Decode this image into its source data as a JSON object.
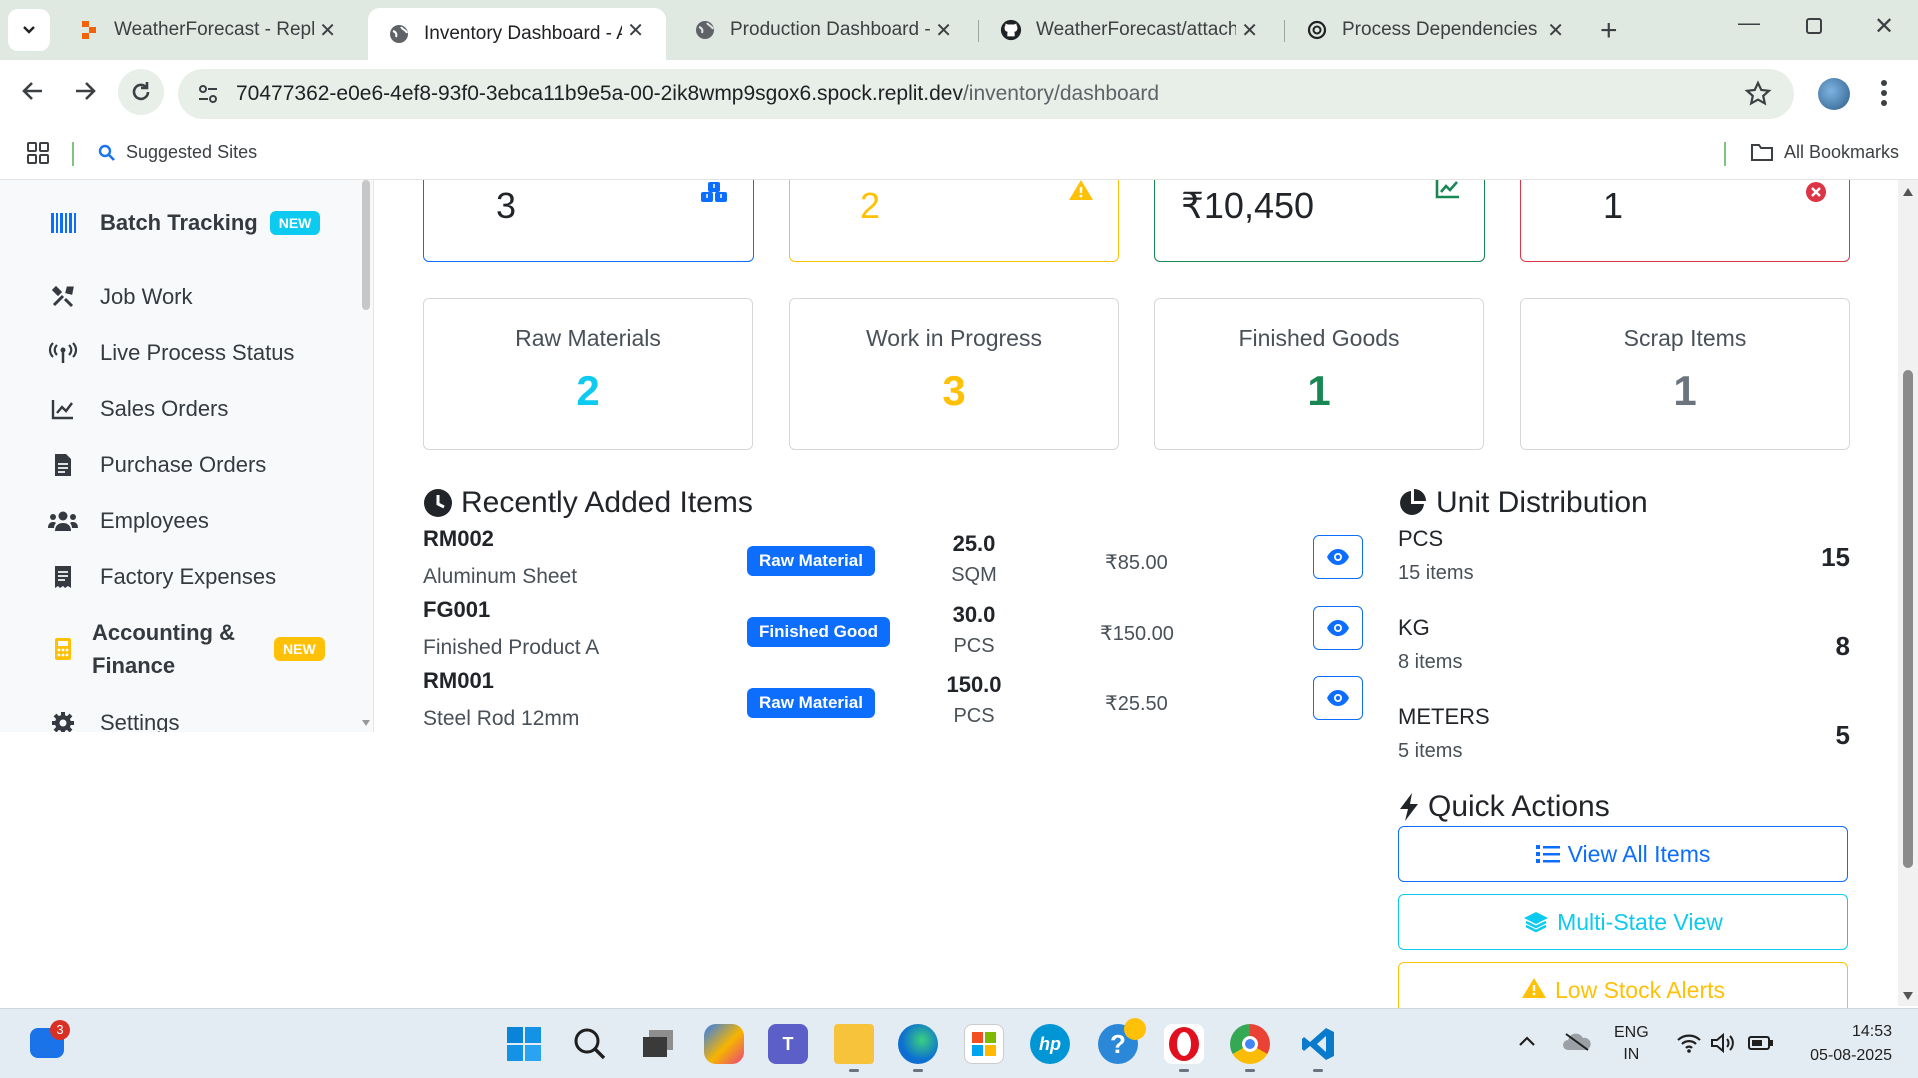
{
  "browser": {
    "tabs": [
      {
        "title": "WeatherForecast - Replit",
        "icon": "replit-icon"
      },
      {
        "title": "Inventory Dashboard - AI",
        "icon": "globe-icon",
        "active": true
      },
      {
        "title": "Production Dashboard - I",
        "icon": "globe-icon"
      },
      {
        "title": "WeatherForecast/attache",
        "icon": "github-icon"
      },
      {
        "title": "Process Dependencies O",
        "icon": "openai-icon"
      }
    ],
    "url_host": "70477362-e0e6-4ef8-93f0-3ebca11b9e5a-00-2ik8wmp9sgox6.spock.replit.dev",
    "url_path": "/inventory/dashboard",
    "bookmarks": {
      "suggested": "Suggested Sites",
      "all": "All Bookmarks"
    }
  },
  "sidebar": {
    "items": [
      {
        "label": "Batch Tracking",
        "icon": "barcode-icon",
        "badge": "NEW",
        "bold": true
      },
      {
        "label": "Job Work",
        "icon": "tools-icon"
      },
      {
        "label": "Live Process Status",
        "icon": "broadcast-icon"
      },
      {
        "label": "Sales Orders",
        "icon": "chart-line-icon"
      },
      {
        "label": "Purchase Orders",
        "icon": "document-icon"
      },
      {
        "label": "Employees",
        "icon": "users-icon"
      },
      {
        "label": "Factory Expenses",
        "icon": "receipt-icon"
      },
      {
        "label": "Accounting &",
        "label2": "Finance",
        "icon": "calculator-icon",
        "badge": "NEW",
        "bold": true
      },
      {
        "label": "Settings",
        "icon": "gear-icon"
      }
    ]
  },
  "stats": [
    {
      "value": "3",
      "color": "#0d6efd",
      "icon": "boxes-icon"
    },
    {
      "value": "2",
      "color": "#ffc107",
      "icon": "warning-icon"
    },
    {
      "value": "₹10,450",
      "color": "#198754",
      "icon": "chart-up-icon"
    },
    {
      "value": "1",
      "color": "#dc3545",
      "icon": "x-circle-icon"
    }
  ],
  "summary": [
    {
      "label": "Raw Materials",
      "value": "2",
      "color": "#0dcaf0"
    },
    {
      "label": "Work in Progress",
      "value": "3",
      "color": "#ffc107"
    },
    {
      "label": "Finished Goods",
      "value": "1",
      "color": "#198754"
    },
    {
      "label": "Scrap Items",
      "value": "1",
      "color": "#6c757d"
    }
  ],
  "recent": {
    "title": "Recently Added Items",
    "items": [
      {
        "code": "RM002",
        "name": "Aluminum Sheet",
        "type": "Raw Material",
        "qty": "25.0",
        "unit": "SQM",
        "price": "₹85.00"
      },
      {
        "code": "FG001",
        "name": "Finished Product A",
        "type": "Finished Good",
        "qty": "30.0",
        "unit": "PCS",
        "price": "₹150.00"
      },
      {
        "code": "RM001",
        "name": "Steel Rod 12mm",
        "type": "Raw Material",
        "qty": "150.0",
        "unit": "PCS",
        "price": "₹25.50"
      }
    ]
  },
  "units": {
    "title": "Unit Distribution",
    "items": [
      {
        "name": "PCS",
        "sub": "15 items",
        "count": "15"
      },
      {
        "name": "KG",
        "sub": "8 items",
        "count": "8"
      },
      {
        "name": "METERS",
        "sub": "5 items",
        "count": "5"
      }
    ]
  },
  "quick": {
    "title": "Quick Actions",
    "actions": [
      {
        "label": "View All Items",
        "color": "#0d6efd",
        "icon": "list-icon"
      },
      {
        "label": "Multi-State View",
        "color": "#0dcaf0",
        "icon": "layers-icon"
      },
      {
        "label": "Low Stock Alerts",
        "color": "#ffc107",
        "icon": "warning-icon"
      }
    ]
  },
  "taskbar": {
    "lang": "ENG",
    "region": "IN",
    "time": "14:53",
    "date": "05-08-2025",
    "notification_count": "3"
  }
}
